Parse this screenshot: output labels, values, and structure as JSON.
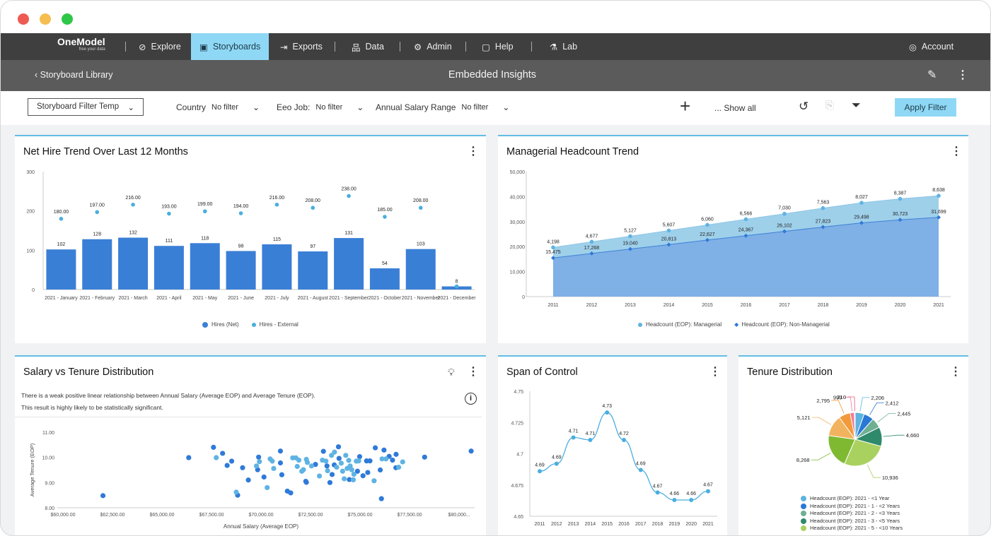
{
  "window": {
    "controls": {
      "close": "#ee5a52",
      "minimize": "#f5be4f",
      "maximize": "#2fc748"
    }
  },
  "nav": {
    "logo": "OneModel",
    "logo_tagline": "free your data",
    "items": [
      {
        "label": "Explore",
        "icon": "compass-icon"
      },
      {
        "label": "Storyboards",
        "icon": "storyboard-icon",
        "active": true
      },
      {
        "label": "Exports",
        "icon": "export-icon"
      },
      {
        "label": "Data",
        "icon": "hierarchy-icon"
      },
      {
        "label": "Admin",
        "icon": "gear-icon"
      },
      {
        "label": "Help",
        "icon": "help-icon"
      },
      {
        "label": "Lab",
        "icon": "lab-icon"
      }
    ],
    "account": "Account",
    "accent": "#8fd8f5"
  },
  "subheader": {
    "back": "Storyboard Library",
    "title": "Embedded Insights"
  },
  "filters": {
    "template": "Storyboard Filter Temp",
    "items": [
      {
        "label": "Country",
        "value": "No filter"
      },
      {
        "label": "Eeo Job:",
        "value": "No filter"
      },
      {
        "label": "Annual Salary Range",
        "value": "No filter"
      }
    ],
    "show_all": "... Show all",
    "apply": "Apply Filter"
  },
  "cards": {
    "net_hire": {
      "title": "Net Hire Trend Over Last 12 Months"
    },
    "managerial": {
      "title": "Managerial Headcount Trend"
    },
    "salary": {
      "title": "Salary vs Tenure Distribution",
      "insight1": "There is a weak positive linear relationship between Annual Salary (Average EOP) and Average Tenure (EOP).",
      "insight2": "This result is highly likely to be statistically significant."
    },
    "span": {
      "title": "Span of Control"
    },
    "tenure": {
      "title": "Tenure Distribution"
    }
  },
  "chart_data": [
    {
      "type": "bar",
      "id": "net_hire",
      "categories": [
        "2021 - January",
        "2021 - February",
        "2021 - March",
        "2021 - April",
        "2021 - May",
        "2021 - June",
        "2021 - July",
        "2021 - August",
        "2021 - September",
        "2021 - October",
        "2021 - November",
        "2021 - December"
      ],
      "series": [
        {
          "name": "Hires (Net)",
          "type": "bar",
          "color": "#3a7fd6",
          "values": [
            102,
            128,
            132,
            111,
            118,
            98,
            115,
            97,
            131,
            54,
            103,
            8
          ],
          "labels": [
            "102",
            "128",
            "132",
            "111",
            "118",
            "98",
            "115",
            "97",
            "131",
            "54",
            "103",
            "8"
          ]
        },
        {
          "name": "Hires - External",
          "type": "scatter",
          "color": "#4aaee0",
          "values": [
            180,
            197,
            216,
            193,
            199,
            194,
            216,
            208,
            238,
            185,
            208,
            8
          ],
          "labels": [
            "180.00",
            "197.00",
            "216.00",
            "193.00",
            "199.00",
            "194.00",
            "216.00",
            "208.00",
            "238.00",
            "185.00",
            "208.00",
            ""
          ]
        }
      ],
      "ylim": [
        0,
        300
      ],
      "yticks": [
        "0",
        "100",
        "200",
        "300"
      ],
      "legend": "bottom"
    },
    {
      "type": "area",
      "id": "managerial",
      "stacked": true,
      "x": [
        "2011",
        "2012",
        "2013",
        "2014",
        "2015",
        "2016",
        "2017",
        "2018",
        "2019",
        "2020",
        "2021"
      ],
      "series": [
        {
          "name": "Headcount (EOP): Managerial",
          "color": "#9fd0ea",
          "values": [
            4198,
            4677,
            5127,
            5607,
            6060,
            6566,
            7030,
            7563,
            8027,
            8387,
            8638
          ],
          "labels": [
            "4,198",
            "4,677",
            "5,127",
            "5,607",
            "6,060",
            "6,566",
            "7,030",
            "7,563",
            "8,027",
            "8,387",
            "8,638"
          ]
        },
        {
          "name": "Headcount (EOP): Non-Managerial",
          "color": "#7fb0e6",
          "values": [
            15475,
            17268,
            19040,
            20813,
            22627,
            24367,
            26102,
            27823,
            29498,
            30723,
            31699
          ],
          "labels": [
            "15,475",
            "17,268",
            "19,040",
            "20,813",
            "22,627",
            "24,367",
            "26,102",
            "27,823",
            "29,498",
            "30,723",
            "31,699"
          ]
        }
      ],
      "ylim": [
        0,
        50000
      ],
      "yticks": [
        "0",
        "10,000",
        "20,000",
        "30,000",
        "40,000",
        "50,000"
      ],
      "legend": "bottom"
    },
    {
      "type": "scatter",
      "id": "salary",
      "xlabel": "Annual Salary (Average EOP)",
      "ylabel": "Average Tenure (EOP)",
      "xlim": [
        60000,
        80000
      ],
      "ylim": [
        8,
        11
      ],
      "xticks": [
        "$60,000.00",
        "$62,500.00",
        "$65,000.00",
        "$67,500.00",
        "$70,000.00",
        "$72,500.00",
        "$75,000.00",
        "$77,500.00",
        "$80,000..."
      ],
      "yticks": [
        "8.00",
        "9.00",
        "10.00",
        "11.00"
      ],
      "series": [
        {
          "color": "#2f7ad8",
          "points": [
            [
              62020,
              8.48
            ],
            [
              66350,
              9.99
            ],
            [
              67600,
              10.4
            ],
            [
              68060,
              10.16
            ],
            [
              68290,
              9.68
            ],
            [
              68520,
              9.85
            ],
            [
              68820,
              8.5
            ],
            [
              69070,
              9.59
            ],
            [
              69360,
              9.1
            ],
            [
              69830,
              9.51
            ],
            [
              69880,
              10.01
            ],
            [
              70150,
              9.22
            ],
            [
              70980,
              10.25
            ],
            [
              70980,
              9.78
            ],
            [
              71050,
              9.31
            ],
            [
              71330,
              8.66
            ],
            [
              71500,
              8.59
            ],
            [
              72260,
              9.05
            ],
            [
              72290,
              9.01
            ],
            [
              72750,
              9.72
            ],
            [
              73150,
              10.24
            ],
            [
              73330,
              9.66
            ],
            [
              73480,
              9.0
            ],
            [
              73590,
              9.32
            ],
            [
              73700,
              9.7
            ],
            [
              73910,
              10.42
            ],
            [
              73940,
              9.96
            ],
            [
              74460,
              9.12
            ],
            [
              74870,
              9.45
            ],
            [
              74980,
              10.03
            ],
            [
              75150,
              9.27
            ],
            [
              75390,
              9.4
            ],
            [
              75330,
              9.86
            ],
            [
              75500,
              9.86
            ],
            [
              75770,
              10.38
            ],
            [
              76020,
              9.5
            ],
            [
              76080,
              8.36
            ],
            [
              76210,
              10.29
            ],
            [
              76470,
              10.04
            ],
            [
              76640,
              9.89
            ],
            [
              76820,
              10.12
            ],
            [
              76810,
              9.59
            ],
            [
              78260,
              10.01
            ],
            [
              80610,
              10.25
            ]
          ]
        },
        {
          "color": "#5fb3e3",
          "points": [
            [
              67740,
              9.99
            ],
            [
              68750,
              8.62
            ],
            [
              69770,
              9.66
            ],
            [
              69920,
              9.83
            ],
            [
              70310,
              8.8
            ],
            [
              70460,
              9.94
            ],
            [
              70570,
              9.85
            ],
            [
              70640,
              9.56
            ],
            [
              71600,
              9.98
            ],
            [
              71760,
              9.98
            ],
            [
              71910,
              9.89
            ],
            [
              71830,
              9.64
            ],
            [
              72060,
              9.45
            ],
            [
              72140,
              9.51
            ],
            [
              72290,
              9.92
            ],
            [
              72340,
              9.8
            ],
            [
              72550,
              9.66
            ],
            [
              72950,
              9.26
            ],
            [
              73100,
              9.89
            ],
            [
              73280,
              9.85
            ],
            [
              73360,
              9.47
            ],
            [
              73560,
              10.08
            ],
            [
              73710,
              10.21
            ],
            [
              73820,
              9.61
            ],
            [
              74050,
              9.77
            ],
            [
              74120,
              9.45
            ],
            [
              74200,
              9.15
            ],
            [
              74280,
              10.08
            ],
            [
              74350,
              9.56
            ],
            [
              74430,
              9.88
            ],
            [
              74500,
              9.66
            ],
            [
              74580,
              9.51
            ],
            [
              74660,
              9.11
            ],
            [
              74690,
              9.33
            ],
            [
              74810,
              9.85
            ],
            [
              74930,
              9.86
            ],
            [
              75710,
              9.07
            ],
            [
              76110,
              9.94
            ],
            [
              76310,
              9.94
            ],
            [
              76950,
              9.61
            ],
            [
              77150,
              9.82
            ]
          ]
        }
      ]
    },
    {
      "type": "line",
      "id": "span",
      "x": [
        "2011",
        "2012",
        "2013",
        "2014",
        "2015",
        "2016",
        "2017",
        "2018",
        "2019",
        "2020",
        "2021"
      ],
      "ylim": [
        4.65,
        4.75
      ],
      "yticks": [
        "4.65",
        "4.675",
        "4.7",
        "4.725",
        "4.75"
      ],
      "series": [
        {
          "color": "#4aaee0",
          "values": [
            4.686,
            4.692,
            4.713,
            4.711,
            4.733,
            4.711,
            4.687,
            4.669,
            4.663,
            4.663,
            4.67
          ],
          "labels": [
            "4.69",
            "4.69",
            "4.71",
            "4.71",
            "4.73",
            "4.72",
            "4.69",
            "4.67",
            "4.66",
            "4.66",
            "4.67"
          ]
        }
      ]
    },
    {
      "type": "pie",
      "id": "tenure",
      "slices": [
        {
          "label": "2,206",
          "value": 2206,
          "color": "#5db4e0"
        },
        {
          "label": "2,412",
          "value": 2412,
          "color": "#2a78d6"
        },
        {
          "label": "2,445",
          "value": 2445,
          "color": "#6fb093"
        },
        {
          "label": "4,660",
          "value": 4660,
          "color": "#2e8a6a"
        },
        {
          "label": "10,936",
          "value": 10936,
          "color": "#a9d160"
        },
        {
          "label": "8,268",
          "value": 8268,
          "color": "#7fb932"
        },
        {
          "label": "5,121",
          "value": 5121,
          "color": "#f2b35e"
        },
        {
          "label": "2,795",
          "value": 2795,
          "color": "#f29a3a"
        },
        {
          "label": "999",
          "value": 999,
          "color": "#f07a9a"
        },
        {
          "label": "210",
          "value": 210,
          "color": "#e95b7b"
        }
      ],
      "legend": [
        "Headcount (EOP): 2021 - <1 Year",
        "Headcount (EOP): 2021 - 1 - <2 Years",
        "Headcount (EOP): 2021 - 2 - <3 Years",
        "Headcount (EOP): 2021 - 3 - <5 Years",
        "Headcount (EOP): 2021 - 5 - <10 Years"
      ],
      "legend_colors": [
        "#5db4e0",
        "#2a78d6",
        "#6fb093",
        "#2e8a6a",
        "#a9d160"
      ]
    }
  ]
}
